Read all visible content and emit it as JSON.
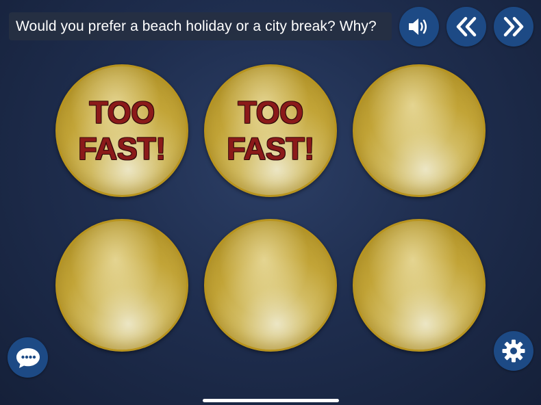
{
  "question": {
    "text": "Would you prefer a beach holiday or a city break? Why?"
  },
  "toolbar": {
    "audio_icon": "speaker-icon",
    "previous_icon": "double-chevron-left-icon",
    "next_icon": "double-chevron-right-icon"
  },
  "coins": [
    {
      "label": "TOO\nFAST!",
      "revealed": true
    },
    {
      "label": "TOO\nFAST!",
      "revealed": true
    },
    {
      "label": "",
      "revealed": false
    },
    {
      "label": "",
      "revealed": false
    },
    {
      "label": "",
      "revealed": false
    },
    {
      "label": "",
      "revealed": false
    }
  ],
  "footer": {
    "chat_icon": "chat-bubble-icon",
    "settings_icon": "gear-icon"
  },
  "colors": {
    "button_blue": "#1d4a85",
    "coin_gold": "#c2a437",
    "label_red": "#8b1a1a",
    "background_navy": "#1f2e4f"
  }
}
